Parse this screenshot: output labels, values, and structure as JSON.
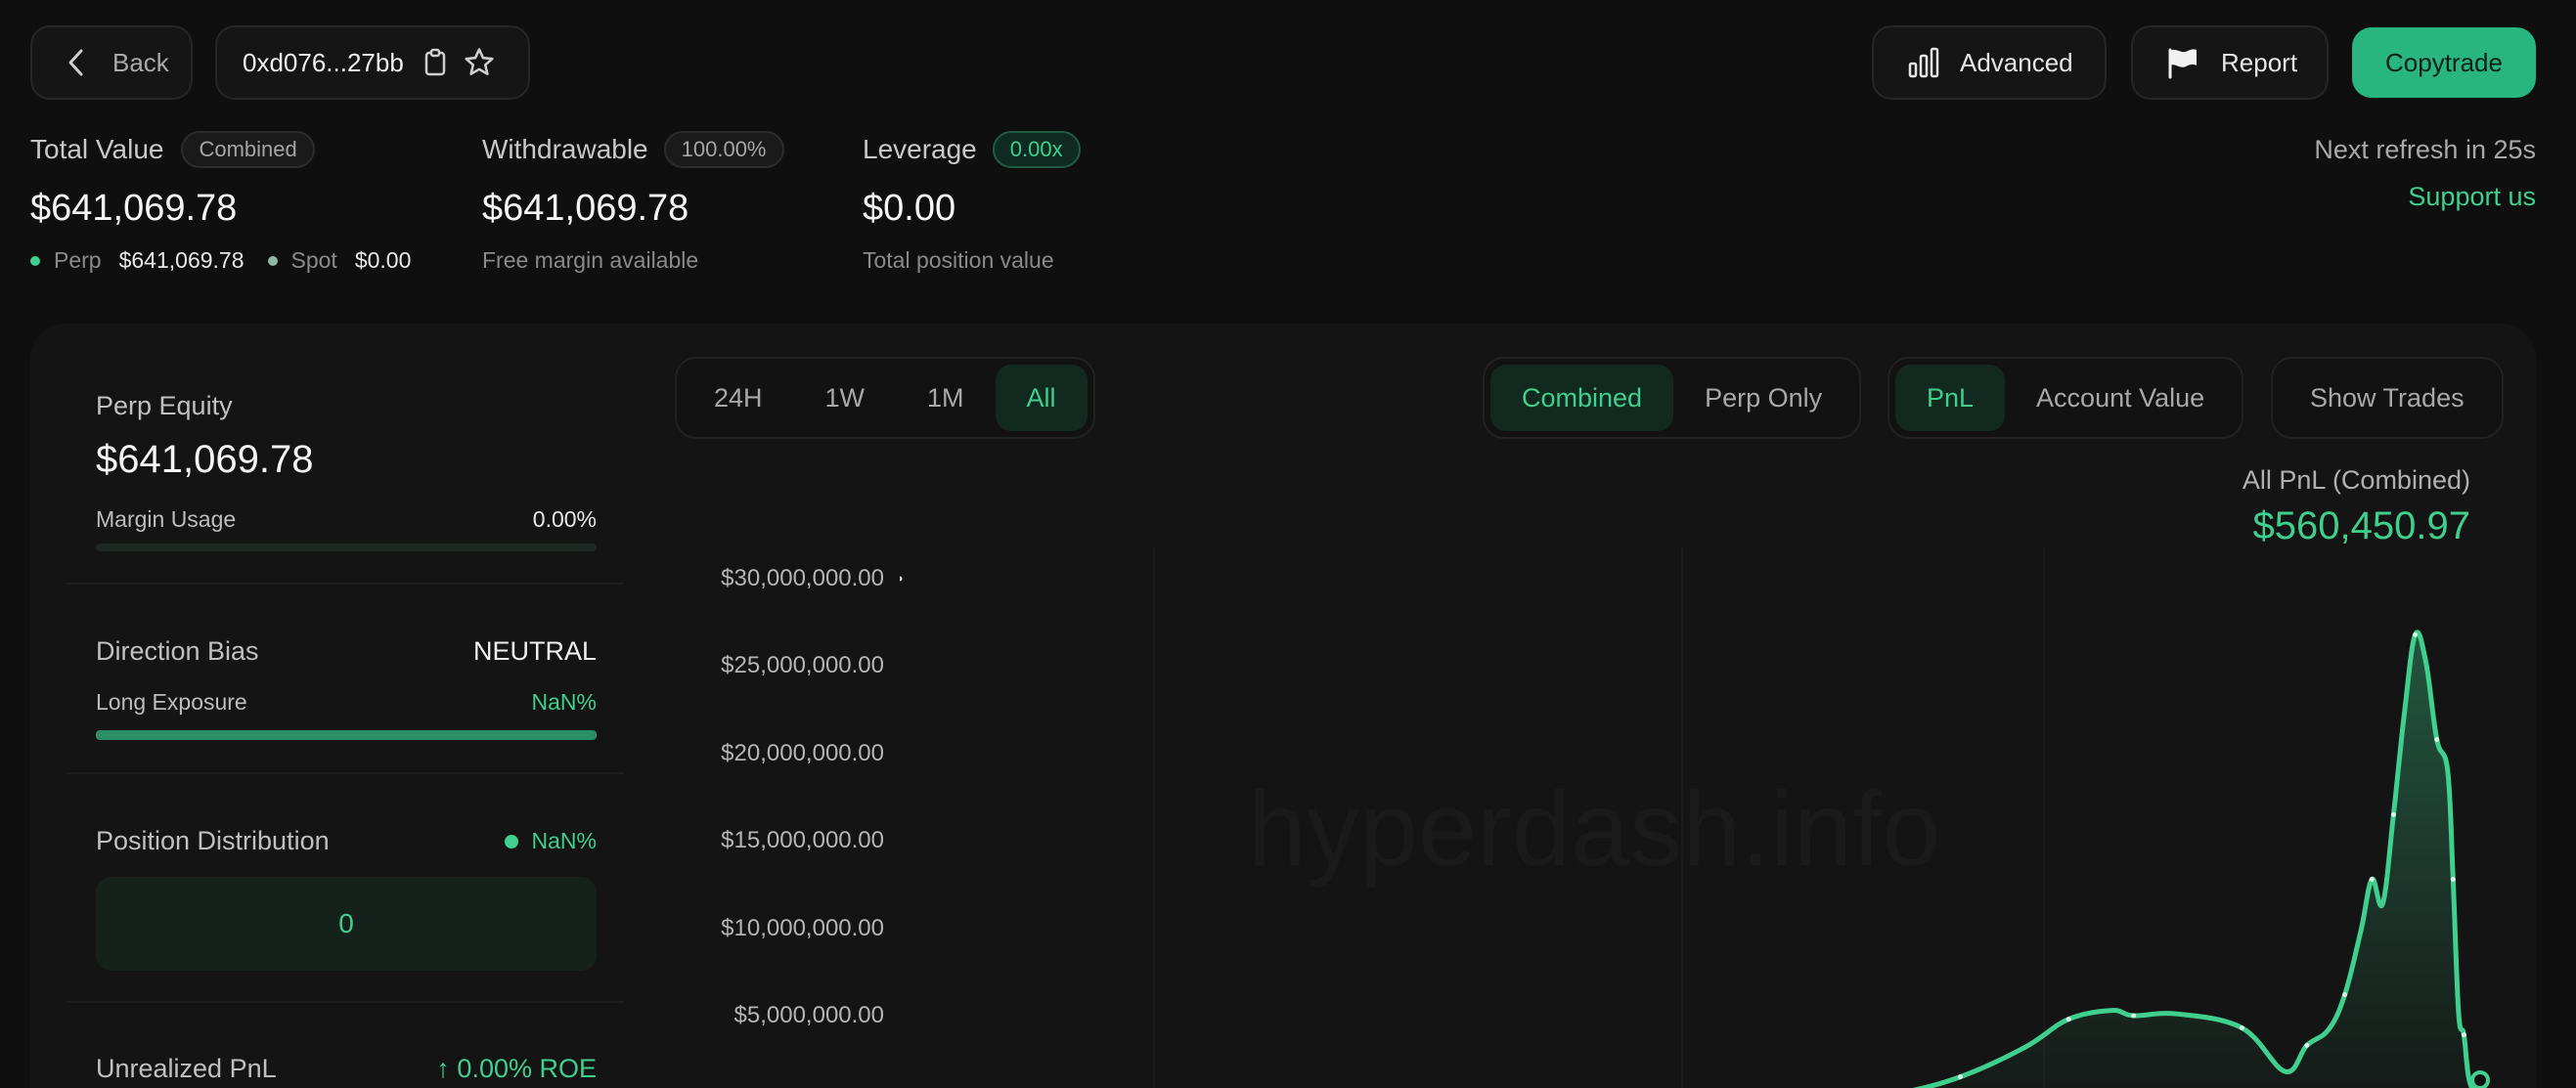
{
  "header": {
    "back_label": "Back",
    "address": "0xd076...27bb",
    "advanced_label": "Advanced",
    "report_label": "Report",
    "copytrade_label": "Copytrade"
  },
  "summary": {
    "total_value": {
      "label": "Total Value",
      "badge": "Combined",
      "value": "$641,069.78",
      "perp_label": "Perp",
      "perp_value": "$641,069.78",
      "spot_label": "Spot",
      "spot_value": "$0.00"
    },
    "withdrawable": {
      "label": "Withdrawable",
      "badge": "100.00%",
      "value": "$641,069.78",
      "sub": "Free margin available"
    },
    "leverage": {
      "label": "Leverage",
      "badge": "0.00x",
      "value": "$0.00",
      "sub": "Total position value"
    },
    "refresh": "Next refresh in 25s",
    "support": "Support us"
  },
  "left_panel": {
    "perp_equity_label": "Perp Equity",
    "perp_equity_value": "$641,069.78",
    "margin_usage_label": "Margin Usage",
    "margin_usage_value": "0.00%",
    "direction_bias_label": "Direction Bias",
    "direction_bias_value": "NEUTRAL",
    "long_exposure_label": "Long Exposure",
    "long_exposure_value": "NaN%",
    "position_dist_label": "Position Distribution",
    "position_dist_value": "NaN%",
    "position_count": "0",
    "unrealized_label": "Unrealized PnL",
    "unrealized_value": "↑ 0.00% ROE"
  },
  "controls": {
    "timeframes": [
      "24H",
      "1W",
      "1M",
      "All"
    ],
    "timeframe_active": 3,
    "modes": [
      "Combined",
      "Perp Only"
    ],
    "mode_active": 0,
    "metrics": [
      "PnL",
      "Account Value"
    ],
    "metric_active": 0,
    "show_trades": "Show Trades"
  },
  "chart_meta": {
    "caption": "All PnL (Combined)",
    "value": "$560,450.97",
    "watermark": "hyperdash.info"
  },
  "colors": {
    "accent": "#3fcf8e",
    "background": "#0f0f0f",
    "panel": "#141414"
  },
  "chart_data": {
    "type": "area",
    "ylabel": "",
    "y_ticks": [
      "$30,000,000.00",
      "$25,000,000.00",
      "$20,000,000.00",
      "$15,000,000.00",
      "$10,000,000.00",
      "$5,000,000.00"
    ],
    "ylim": [
      0,
      30000000
    ],
    "x": [
      0,
      0.18,
      0.3,
      0.4,
      0.46,
      0.54,
      0.6,
      0.66,
      0.7,
      0.74,
      0.76,
      0.8,
      0.86,
      0.9,
      0.92,
      0.94,
      0.955,
      0.97,
      0.98,
      0.99,
      1.0,
      1.01,
      1.02,
      1.03,
      1.04,
      1.05,
      1.055,
      1.06,
      1.065,
      1.07,
      1.08
    ],
    "values": [
      -400000,
      -300000,
      -200000,
      100000,
      -400000,
      500000,
      1500000,
      3200000,
      4800000,
      5300000,
      5000000,
      5100000,
      4300000,
      1800000,
      3300000,
      4200000,
      6200000,
      9900000,
      12800000,
      11400000,
      16500000,
      22300000,
      26800000,
      25200000,
      20800000,
      19000000,
      12800000,
      5200000,
      3900000,
      1300000,
      0
    ],
    "series": [
      {
        "values_ref": "values"
      }
    ]
  }
}
